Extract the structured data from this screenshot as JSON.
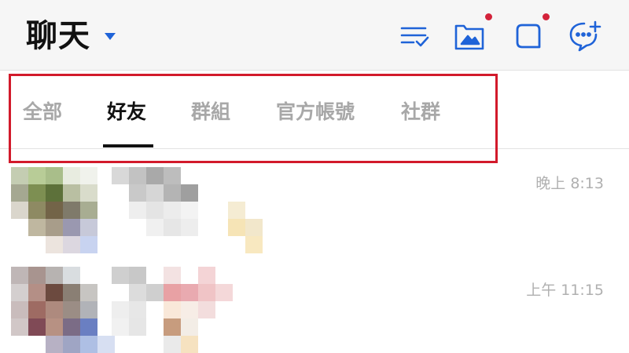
{
  "header": {
    "title": "聊天",
    "icons": [
      "checklist-icon",
      "photo-folder-icon",
      "square-chat-icon",
      "add-chat-icon"
    ],
    "accent": "#1f63d8",
    "badge_color": "#d3223a"
  },
  "tabs": [
    {
      "label": "全部",
      "active": false
    },
    {
      "label": "好友",
      "active": true
    },
    {
      "label": "群組",
      "active": false
    },
    {
      "label": "官方帳號",
      "active": false
    },
    {
      "label": "社群",
      "active": false
    }
  ],
  "chats": [
    {
      "time": "晚上 8:13"
    },
    {
      "time": "上午 11:15"
    }
  ]
}
